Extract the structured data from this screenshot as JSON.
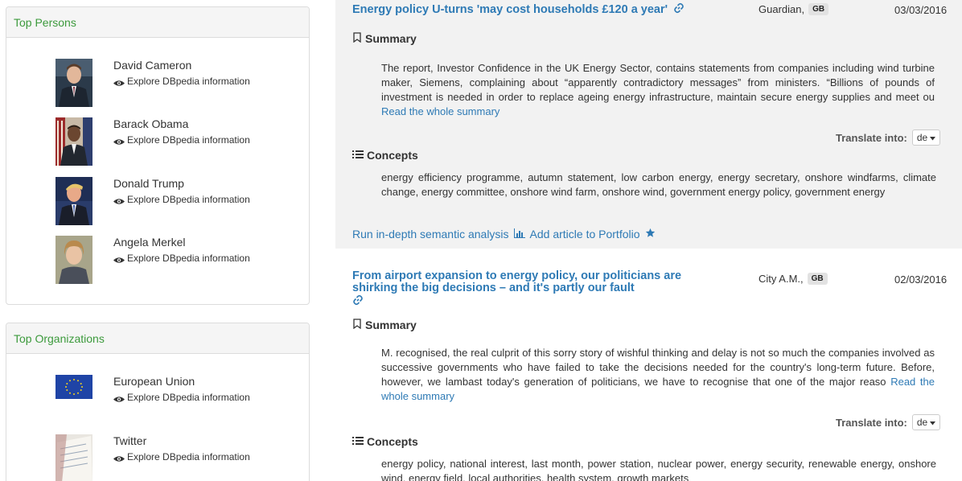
{
  "persons": {
    "title": "Top Persons",
    "explore_label": "Explore DBpedia information",
    "items": [
      {
        "name": "David Cameron"
      },
      {
        "name": "Barack Obama"
      },
      {
        "name": "Donald Trump"
      },
      {
        "name": "Angela Merkel"
      }
    ]
  },
  "organizations": {
    "title": "Top Organizations",
    "explore_label": "Explore DBpedia information",
    "items": [
      {
        "name": "European Union"
      },
      {
        "name": "Twitter"
      }
    ]
  },
  "labels": {
    "summary": "Summary",
    "concepts": "Concepts",
    "read_more": "Read the whole summary",
    "translate": "Translate into:",
    "translate_lang": "de",
    "run_analysis": "Run in-depth semantic analysis",
    "add_portfolio": "Add article to Portfolio"
  },
  "articles": [
    {
      "title": "Energy policy U-turns 'may cost households £120 a year'",
      "source": "Guardian,",
      "country": "GB",
      "date": "03/03/2016",
      "summary": "The report, Investor Confidence in the UK Energy Sector, contains statements from companies including wind turbine maker, Siemens, complaining about “apparently contradictory messages” from ministers. “Billions of pounds of investment is needed in order to replace ageing energy infrastructure, maintain secure energy supplies and meet ou",
      "concepts": "energy efficiency programme, autumn statement, low carbon energy, energy secretary, onshore windfarms, climate change, energy committee, onshore wind farm, onshore wind, government energy policy, government energy"
    },
    {
      "title": "From airport expansion to energy policy, our politicians are shirking the big decisions – and it's partly our fault",
      "source": "City A.M.,",
      "country": "GB",
      "date": "02/03/2016",
      "summary": "M. recognised, the real culprit of this sorry story of wishful thinking and delay is not so much the companies involved as successive governments who have failed to take the decisions needed for the country's long-term future. Before, however, we lambast today's generation of politicians, we have to recognise that one of the major reaso",
      "concepts": "energy policy, national interest, last month, power station, nuclear power, energy security, renewable energy, onshore wind, energy field, local authorities, health system, growth markets"
    }
  ],
  "colors": {
    "link": "#2e7ab5",
    "panel_title": "#3c9a3c",
    "article_bg": "#f2f2f2"
  }
}
